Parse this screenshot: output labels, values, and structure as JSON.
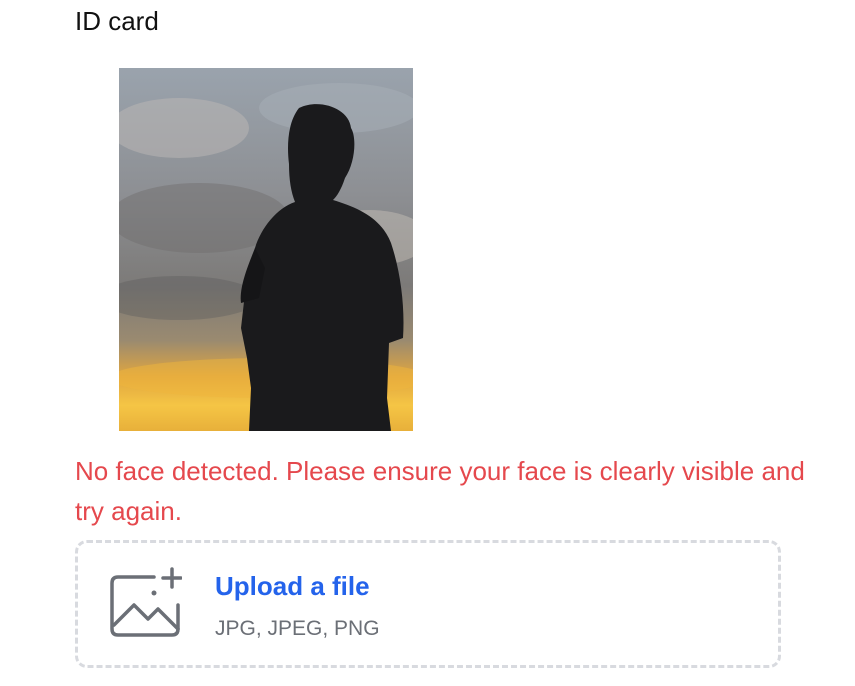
{
  "field": {
    "label": "ID card"
  },
  "preview": {
    "image": "silhouette-photo"
  },
  "error": {
    "message": "No face detected. Please ensure your face is clearly visible and try again."
  },
  "upload": {
    "icon": "image-add-icon",
    "link_label": "Upload a file",
    "accepted_types": "JPG, JPEG, PNG"
  },
  "colors": {
    "error": "#e5484d",
    "link": "#2463eb",
    "hint": "#6b6f76",
    "border": "#d8dadf"
  }
}
